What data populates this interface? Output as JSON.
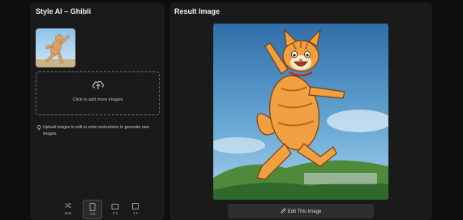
{
  "left_panel": {
    "title": "Style AI – Ghibli",
    "dropzone_label": "Click to add more images",
    "hint_text": "Upload images to edit or enter instructions to generate new images.",
    "aspect_ratios": [
      {
        "label": "auto",
        "icon": "shuffle-icon",
        "active": false
      },
      {
        "label": "2:3",
        "icon": "portrait-ratio-icon",
        "active": true
      },
      {
        "label": "3:2",
        "icon": "landscape-ratio-icon",
        "active": false
      },
      {
        "label": "1:1",
        "icon": "square-ratio-icon",
        "active": false
      }
    ]
  },
  "right_panel": {
    "title": "Result Image",
    "edit_button_label": "Edit This Image"
  },
  "colors": {
    "background": "#0e0e0e",
    "panel": "#1a1a1a",
    "button": "#2e2e2e",
    "sky": "#5b9ac8",
    "cat": "#e8963a"
  }
}
